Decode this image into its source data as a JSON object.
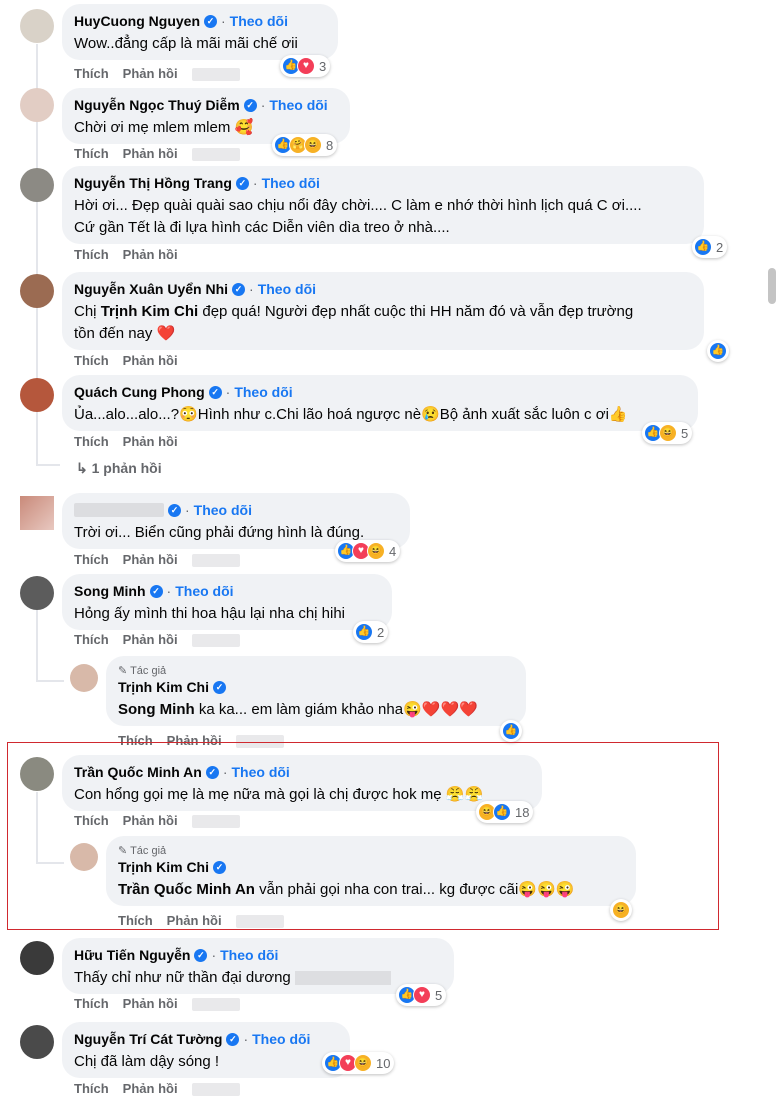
{
  "labels": {
    "follow": "Theo dõi",
    "like": "Thích",
    "reply": "Phản hồi",
    "author": "Tác giả"
  },
  "comments": [
    {
      "name": "HuyCuong Nguyen",
      "text": "Wow..đẳng cấp là mãi mãi chế ơii",
      "reactions": "3"
    },
    {
      "name": "Nguyễn Ngọc Thuý Diễm",
      "text": "Chời ơi mẹ mlem mlem 🥰",
      "reactions": "8"
    },
    {
      "name": "Nguyễn Thị Hồng Trang",
      "text1": "Hời ơi... Đẹp quài quài sao chịu nổi đây chời.... C làm e nhớ thời hình lịch quá C ơi....",
      "text2": "Cứ gần Tết là đi lựa hình các Diễn viên dìa treo ở nhà....",
      "reactions": "2"
    },
    {
      "name": "Nguyễn Xuân Uyển Nhi",
      "text1_a": "Chị ",
      "text1_mention": "Trịnh Kim Chi",
      "text1_b": " đẹp quá! Người đẹp nhất cuộc thi HH năm đó và vẫn đẹp trường",
      "text2": "tồn đến nay ❤️"
    },
    {
      "name": "Quách Cung Phong",
      "text": "Ủa...alo...alo...?😳Hình như c.Chi lão hoá ngược nè😢Bộ ảnh xuất sắc luôn c ơi👍",
      "reactions": "5",
      "replies_link": "1 phản hồi"
    },
    {
      "name": "",
      "text": "Trời ơi... Biển cũng phải đứng hình là đúng.",
      "reactions": "4"
    },
    {
      "name": "Song Minh",
      "text": "Hỏng ấy mình thi hoa hậu lại nha chị hihi",
      "reactions": "2"
    },
    {
      "name": "Trịnh Kim Chi",
      "mention": "Song Minh",
      "text": " ka ka... em làm giám khảo nha😜❤️❤️❤️"
    },
    {
      "name": "Trần Quốc Minh An",
      "text": "Con hổng gọi mẹ là mẹ nữa mà gọi là chị được hok mẹ 😤😤",
      "reactions": "18"
    },
    {
      "name": "Trịnh Kim Chi",
      "mention": "Trần Quốc Minh An",
      "text": " vẫn phải gọi nha con trai... kg được cãi😜😜😜"
    },
    {
      "name": "Hữu Tiến Nguyễn",
      "text": "Thấy chỉ như nữ thần đại dương ",
      "reactions": "5"
    },
    {
      "name": "Nguyễn Trí Cát Tường",
      "text": "Chị đã làm dậy sóng !",
      "reactions": "10"
    }
  ]
}
